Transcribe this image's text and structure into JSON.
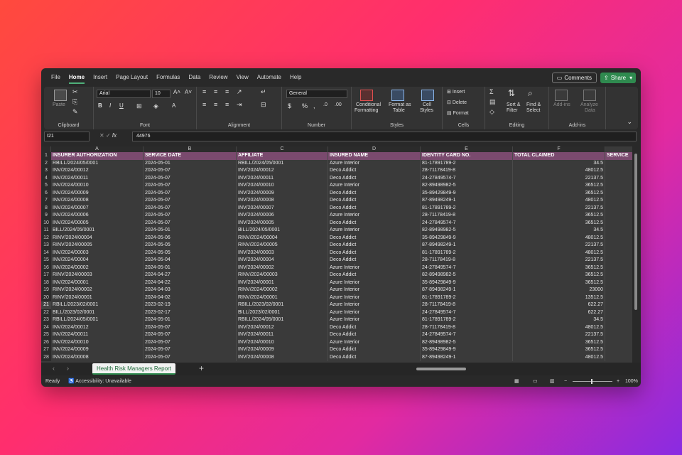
{
  "menu": {
    "items": [
      "File",
      "Home",
      "Insert",
      "Page Layout",
      "Formulas",
      "Data",
      "Review",
      "View",
      "Automate",
      "Help"
    ],
    "active": "Home",
    "comments": "Comments",
    "share": "Share"
  },
  "ribbon": {
    "clipboard": {
      "label": "Clipboard",
      "paste": "Paste"
    },
    "font": {
      "label": "Font",
      "name": "Arial",
      "size": "10"
    },
    "alignment": {
      "label": "Alignment"
    },
    "number": {
      "label": "Number",
      "format": "General"
    },
    "styles": {
      "label": "Styles",
      "conditional": "Conditional",
      "conditional2": "Formatting",
      "format_as": "Format as",
      "format_as2": "Table",
      "cell": "Cell",
      "cell2": "Styles"
    },
    "cells": {
      "label": "Cells",
      "insert": "Insert",
      "delete": "Delete",
      "format": "Format"
    },
    "editing": {
      "label": "Editing",
      "sort": "Sort &",
      "sort2": "Filter",
      "find": "Find &",
      "find2": "Select"
    },
    "addins": {
      "label": "Add-ins",
      "addins_btn": "Add-ins",
      "analyze": "Analyze",
      "analyze2": "Data"
    }
  },
  "formula": {
    "namebox": "I21",
    "value": "44976",
    "fx": "fx"
  },
  "columns": [
    "A",
    "B",
    "C",
    "D",
    "E",
    "F"
  ],
  "headers": [
    "INSURER AUTHORIZATION",
    "SERVICE DATE",
    "AFFILIATE",
    "INSURED NAME",
    "IDENTITY CARD NO.",
    "TOTAL CLAIMED",
    "SERVICE"
  ],
  "rows": [
    [
      "RBILL/2024/05/0001",
      "2024-05-01",
      "RBILL/2024/05/0001",
      "Azure Interior",
      "81-17891789-2",
      "34.5"
    ],
    [
      "INV/2024/00012",
      "2024-05-07",
      "INV/2024/00012",
      "Deco Addict",
      "28-71178419-8",
      "48012.5"
    ],
    [
      "INV/2024/00011",
      "2024-05-07",
      "INV/2024/00011",
      "Deco Addict",
      "24-27849574-7",
      "22137.5"
    ],
    [
      "INV/2024/00010",
      "2024-05-07",
      "INV/2024/00010",
      "Azure Interior",
      "82-89498982-5",
      "36512.5"
    ],
    [
      "INV/2024/00009",
      "2024-05-07",
      "INV/2024/00009",
      "Deco Addict",
      "35-89429849-9",
      "36512.5"
    ],
    [
      "INV/2024/00008",
      "2024-05-07",
      "INV/2024/00008",
      "Deco Addict",
      "87-89498249-1",
      "48012.5"
    ],
    [
      "INV/2024/00007",
      "2024-05-07",
      "INV/2024/00007",
      "Deco Addict",
      "81-17891789-2",
      "22137.5"
    ],
    [
      "INV/2024/00006",
      "2024-05-07",
      "INV/2024/00006",
      "Azure Interior",
      "28-71178419-8",
      "36512.5"
    ],
    [
      "INV/2024/00005",
      "2024-05-07",
      "INV/2024/00005",
      "Deco Addict",
      "24-27849574-7",
      "36512.5"
    ],
    [
      "BILL/2024/05/0001",
      "2024-05-01",
      "BILL/2024/05/0001",
      "Azure Interior",
      "82-89498982-5",
      "34.5"
    ],
    [
      "RINV/2024/00004",
      "2024-05-06",
      "RINV/2024/00004",
      "Deco Addict",
      "35-89429849-9",
      "48012.5"
    ],
    [
      "RINV/2024/00005",
      "2024-05-05",
      "RINV/2024/00005",
      "Deco Addict",
      "87-89498249-1",
      "22137.5"
    ],
    [
      "INV/2024/00003",
      "2024-05-05",
      "INV/2024/00003",
      "Deco Addict",
      "81-17891789-2",
      "48012.5"
    ],
    [
      "INV/2024/00004",
      "2024-05-04",
      "INV/2024/00004",
      "Deco Addict",
      "28-71178419-8",
      "22137.5"
    ],
    [
      "INV/2024/00002",
      "2024-05-01",
      "INV/2024/00002",
      "Azure Interior",
      "24-27849574-7",
      "36512.5"
    ],
    [
      "RINV/2024/00003",
      "2024-04-27",
      "RINV/2024/00003",
      "Deco Addict",
      "82-89498982-5",
      "36512.5"
    ],
    [
      "INV/2024/00001",
      "2024-04-22",
      "INV/2024/00001",
      "Azure Interior",
      "35-89429849-9",
      "36512.5"
    ],
    [
      "RINV/2024/00002",
      "2024-04-03",
      "RINV/2024/00002",
      "Azure Interior",
      "87-89498249-1",
      "23000"
    ],
    [
      "RINV/2024/00001",
      "2024-04-02",
      "RINV/2024/00001",
      "Azure Interior",
      "81-17891789-2",
      "13512.5"
    ],
    [
      "RBILL/2023/02/0001",
      "2023-02-19",
      "RBILL/2023/02/0001",
      "Azure Interior",
      "28-71178419-8",
      "622.27"
    ],
    [
      "BILL/2023/02/0001",
      "2023-02-17",
      "BILL/2023/02/0001",
      "Azure Interior",
      "24-27849574-7",
      "622.27"
    ],
    [
      "RBILL/2024/05/0001",
      "2024-05-01",
      "RBILL/2024/05/0001",
      "Azure Interior",
      "81-17891789-2",
      "34.5"
    ],
    [
      "INV/2024/00012",
      "2024-05-07",
      "INV/2024/00012",
      "Deco Addict",
      "28-71178419-8",
      "48012.5"
    ],
    [
      "INV/2024/00011",
      "2024-05-07",
      "INV/2024/00011",
      "Deco Addict",
      "24-27849574-7",
      "22137.5"
    ],
    [
      "INV/2024/00010",
      "2024-05-07",
      "INV/2024/00010",
      "Azure Interior",
      "82-89498982-5",
      "36512.5"
    ],
    [
      "INV/2024/00009",
      "2024-05-07",
      "INV/2024/00009",
      "Deco Addict",
      "35-89429849-9",
      "36512.5"
    ],
    [
      "INV/2024/00008",
      "2024-05-07",
      "INV/2024/00008",
      "Deco Addict",
      "87-89498249-1",
      "48012.5"
    ]
  ],
  "sheet_tab": "Health Risk Managers Report",
  "status": {
    "ready": "Ready",
    "accessibility": "Accessibility: Unavailable",
    "zoom": "100%"
  }
}
